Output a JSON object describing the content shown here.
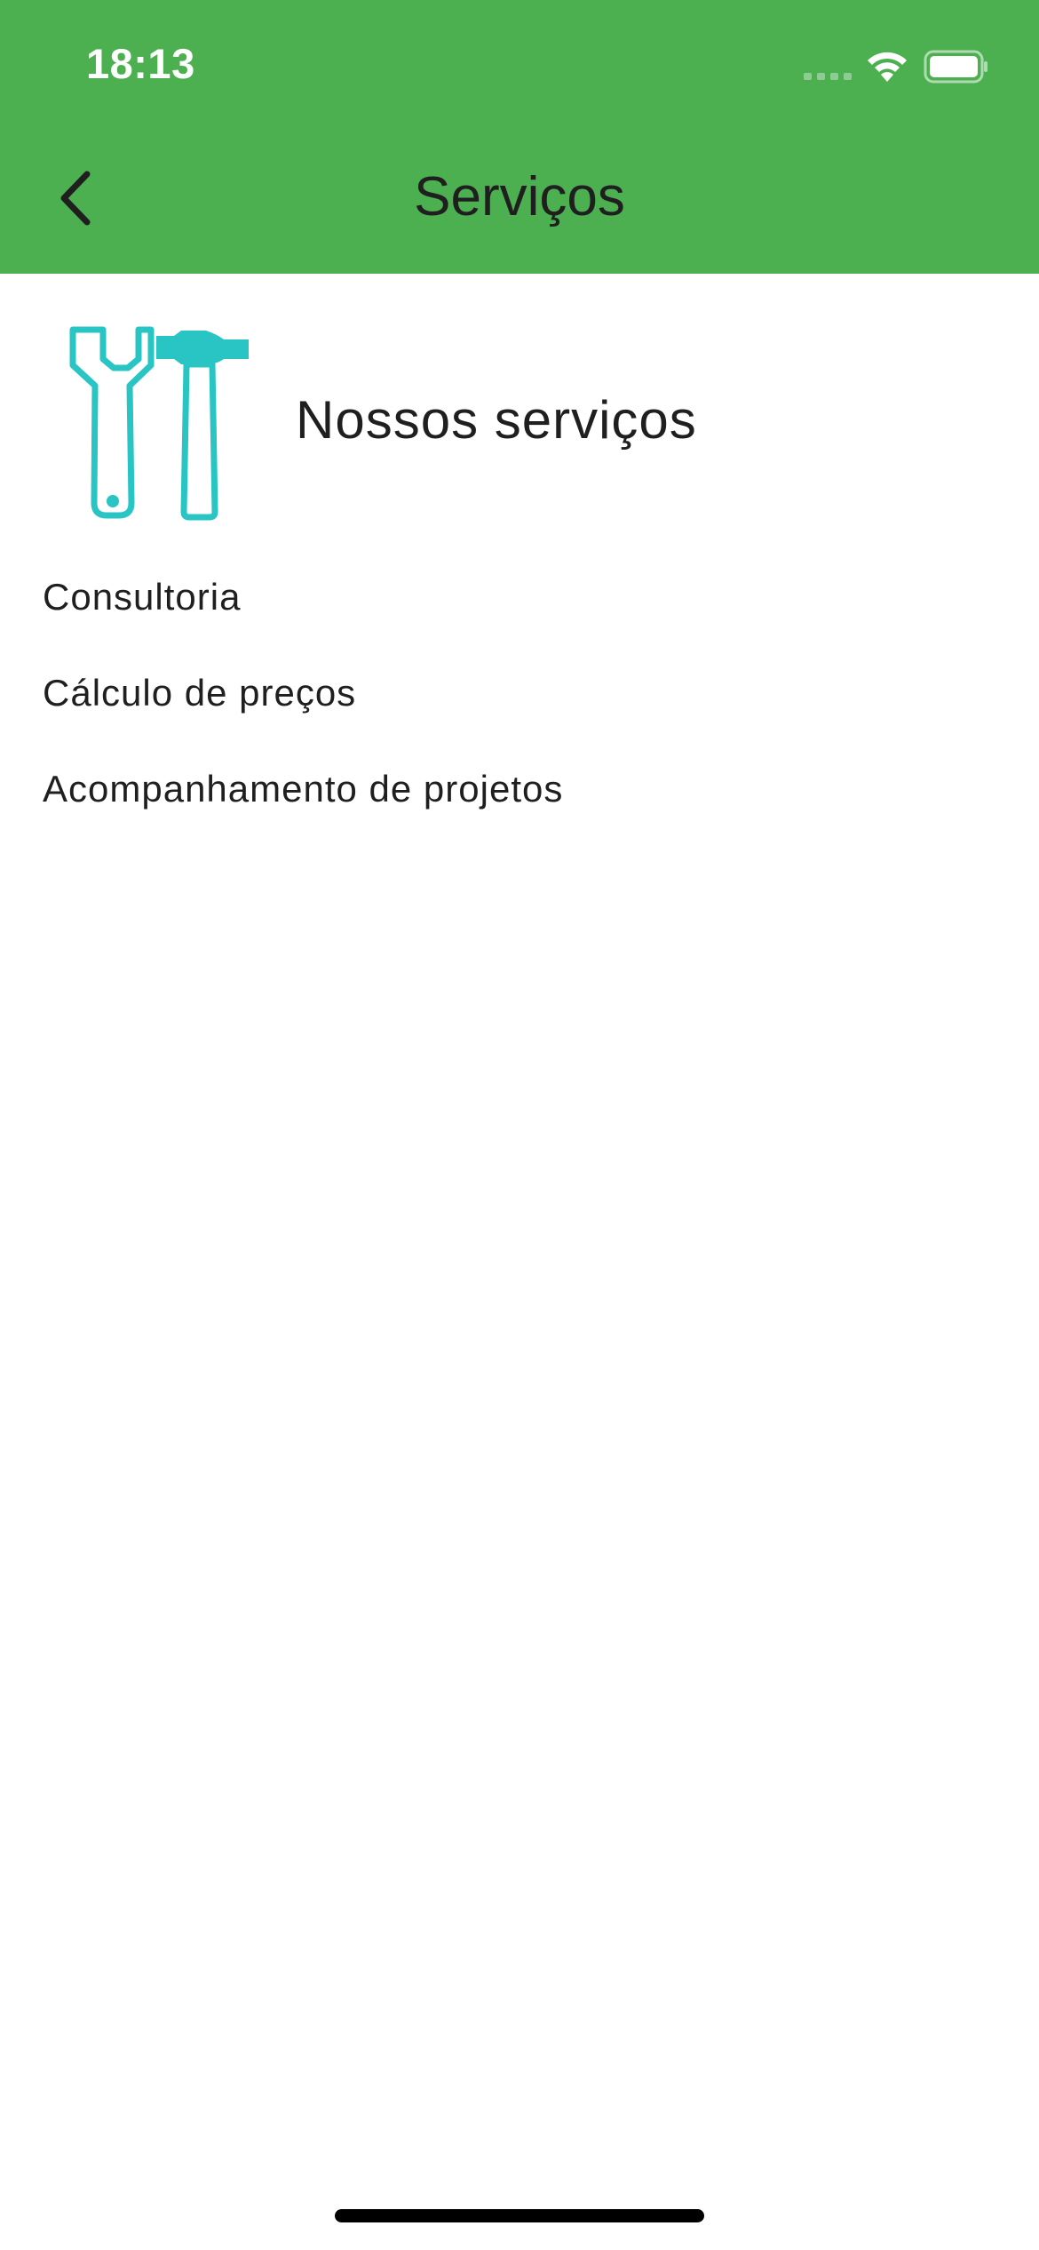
{
  "status_bar": {
    "time": "18:13"
  },
  "header": {
    "title": "Serviços",
    "back_icon": "chevron-left-icon"
  },
  "intro": {
    "icon": "tools-icon",
    "title": "Nossos serviços"
  },
  "services": [
    {
      "label": "Consultoria"
    },
    {
      "label": "Cálculo de preços"
    },
    {
      "label": "Acompanhamento de projetos"
    }
  ],
  "colors": {
    "header_background": "#4CAF50",
    "icon_accent": "#29C4C4",
    "text": "#1F1F1F"
  }
}
